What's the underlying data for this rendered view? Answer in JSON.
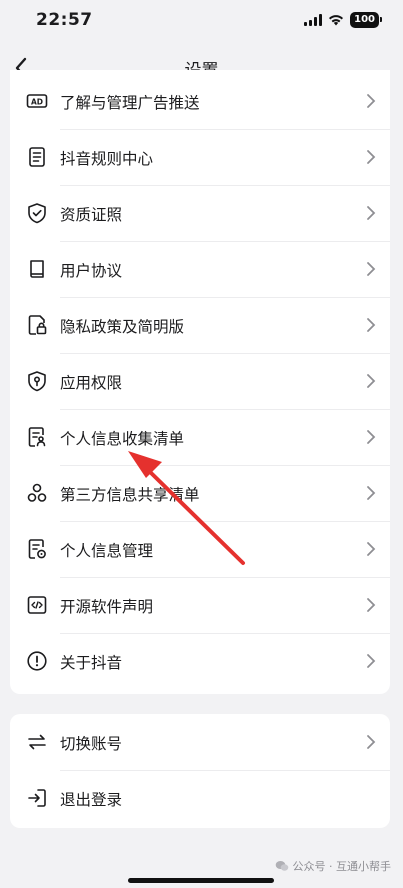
{
  "status": {
    "time": "22:57",
    "battery": "100"
  },
  "nav": {
    "title": "设置"
  },
  "menu_main": [
    {
      "label": "了解与管理广告推送",
      "icon": "ad-icon"
    },
    {
      "label": "抖音规则中心",
      "icon": "document-list-icon"
    },
    {
      "label": "资质证照",
      "icon": "shield-check-icon"
    },
    {
      "label": "用户协议",
      "icon": "book-icon"
    },
    {
      "label": "隐私政策及简明版",
      "icon": "document-lock-icon"
    },
    {
      "label": "应用权限",
      "icon": "shield-key-icon"
    },
    {
      "label": "个人信息收集清单",
      "icon": "document-person-icon"
    },
    {
      "label": "第三方信息共享清单",
      "icon": "share-nodes-icon"
    },
    {
      "label": "个人信息管理",
      "icon": "document-gear-icon"
    },
    {
      "label": "开源软件声明",
      "icon": "code-icon"
    },
    {
      "label": "关于抖音",
      "icon": "info-circle-icon"
    }
  ],
  "menu_account": [
    {
      "label": "切换账号",
      "icon": "switch-arrows-icon"
    },
    {
      "label": "退出登录",
      "icon": "logout-icon"
    }
  ],
  "watermark": {
    "text": "公众号 · 互通小帮手"
  },
  "colors": {
    "arrow": "#e5312e",
    "background": "#f2f2f4",
    "card": "#ffffff"
  }
}
